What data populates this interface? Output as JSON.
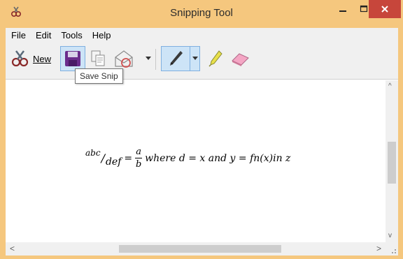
{
  "window": {
    "title": "Snipping Tool",
    "titlebar_color": "#f5c77e",
    "close_color": "#c7463b"
  },
  "menu": [
    "File",
    "Edit",
    "Tools",
    "Help"
  ],
  "toolbar": {
    "new_label": "New",
    "buttons": [
      "new-snip-icon",
      "save-icon",
      "copy-icon",
      "send-snip-icon",
      "pen-icon",
      "highlighter-icon",
      "eraser-icon"
    ]
  },
  "tooltip": "Save Snip",
  "snip": {
    "frac1_num": "abc",
    "frac1_den": "def",
    "equals": "=",
    "frac2_num": "a",
    "frac2_den": "b",
    "rest": "where d = x and y = fn(x)in z"
  }
}
